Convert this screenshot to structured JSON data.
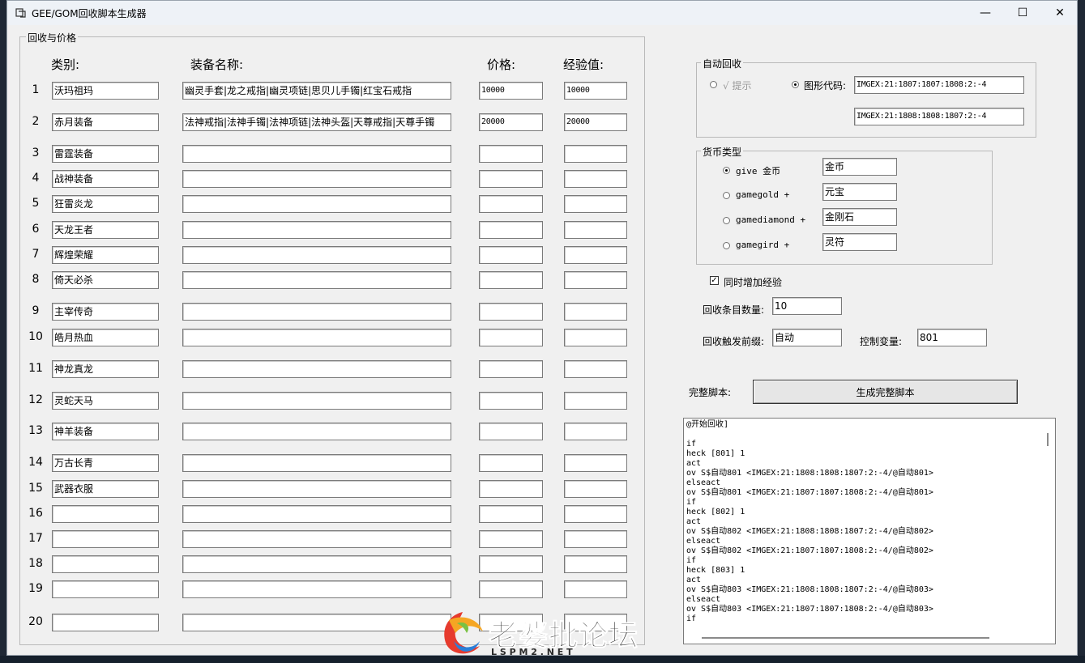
{
  "window": {
    "title": "GEE/GOM回收脚本生成器",
    "minimize": "—",
    "maximize": "☐",
    "close": "✕"
  },
  "recycle_group": {
    "label": "回收与价格",
    "headers": {
      "category": "类别:",
      "equip_name": "装备名称:",
      "price": "价格:",
      "exp": "经验值:"
    },
    "rows": [
      {
        "num": "1",
        "category": "沃玛祖玛",
        "items": "幽灵手套|龙之戒指|幽灵项链|思贝儿手镯|红宝石戒指",
        "price": "10000",
        "exp": "10000"
      },
      {
        "num": "2",
        "category": "赤月装备",
        "items": "法神戒指|法神手镯|法神项链|法神头盔|天尊戒指|天尊手镯",
        "price": "20000",
        "exp": "20000"
      },
      {
        "num": "3",
        "category": "雷霆装备",
        "items": "",
        "price": "",
        "exp": ""
      },
      {
        "num": "4",
        "category": "战神装备",
        "items": "",
        "price": "",
        "exp": ""
      },
      {
        "num": "5",
        "category": "狂雷炎龙",
        "items": "",
        "price": "",
        "exp": ""
      },
      {
        "num": "6",
        "category": "天龙王者",
        "items": "",
        "price": "",
        "exp": ""
      },
      {
        "num": "7",
        "category": "辉煌荣耀",
        "items": "",
        "price": "",
        "exp": ""
      },
      {
        "num": "8",
        "category": "倚天必杀",
        "items": "",
        "price": "",
        "exp": ""
      },
      {
        "num": "9",
        "category": "主宰传奇",
        "items": "",
        "price": "",
        "exp": ""
      },
      {
        "num": "10",
        "category": "皓月热血",
        "items": "",
        "price": "",
        "exp": ""
      },
      {
        "num": "11",
        "category": "神龙真龙",
        "items": "",
        "price": "",
        "exp": ""
      },
      {
        "num": "12",
        "category": "灵蛇天马",
        "items": "",
        "price": "",
        "exp": ""
      },
      {
        "num": "13",
        "category": "神羊装备",
        "items": "",
        "price": "",
        "exp": ""
      },
      {
        "num": "14",
        "category": "万古长青",
        "items": "",
        "price": "",
        "exp": ""
      },
      {
        "num": "15",
        "category": "武器衣服",
        "items": "",
        "price": "",
        "exp": ""
      },
      {
        "num": "16",
        "category": "",
        "items": "",
        "price": "",
        "exp": ""
      },
      {
        "num": "17",
        "category": "",
        "items": "",
        "price": "",
        "exp": ""
      },
      {
        "num": "18",
        "category": "",
        "items": "",
        "price": "",
        "exp": ""
      },
      {
        "num": "19",
        "category": "",
        "items": "",
        "price": "",
        "exp": ""
      },
      {
        "num": "20",
        "category": "",
        "items": "",
        "price": "",
        "exp": ""
      }
    ]
  },
  "auto_recycle": {
    "label": "自动回收",
    "option_hint": "√ 提示",
    "option_graphic": "图形代码:",
    "selected": "graphic",
    "code1": "IMGEX:21:1807:1807:1808:2:-4",
    "code2": "IMGEX:21:1808:1808:1807:2:-4"
  },
  "currency": {
    "label": "货币类型",
    "options": [
      {
        "label": "give 金币",
        "value": "金币",
        "selected": true
      },
      {
        "label": "gamegold +",
        "value": "元宝",
        "selected": false
      },
      {
        "label": "gamediamond +",
        "value": "金刚石",
        "selected": false
      },
      {
        "label": "gamegird +",
        "value": "灵符",
        "selected": false
      }
    ]
  },
  "settings": {
    "add_exp_label": "同时增加经验",
    "add_exp_checked": true,
    "count_label": "回收条目数量:",
    "count_value": "10",
    "prefix_label": "回收触发前缀:",
    "prefix_value": "自动",
    "var_label": "控制变量:",
    "var_value": "801"
  },
  "script": {
    "label": "完整脚本:",
    "generate_button": "生成完整脚本",
    "lines": [
      "@开始回收]",
      "",
      "if",
      "heck [801] 1",
      "act",
      "ov S$自动801 <IMGEX:21:1808:1808:1807:2:-4/@自动801>",
      "elseact",
      "ov S$自动801 <IMGEX:21:1807:1807:1808:2:-4/@自动801>",
      "if",
      "heck [802] 1",
      "act",
      "ov S$自动802 <IMGEX:21:1808:1808:1807:2:-4/@自动802>",
      "elseact",
      "ov S$自动802 <IMGEX:21:1807:1807:1808:2:-4/@自动802>",
      "if",
      "heck [803] 1",
      "act",
      "ov S$自动803 <IMGEX:21:1808:1808:1807:2:-4/@自动803>",
      "elseact",
      "ov S$自动803 <IMGEX:21:1807:1807:1808:2:-4/@自动803>",
      "if"
    ]
  },
  "watermark": {
    "main": "老婆批论坛",
    "sub": "L S P M 2 . N E T"
  }
}
